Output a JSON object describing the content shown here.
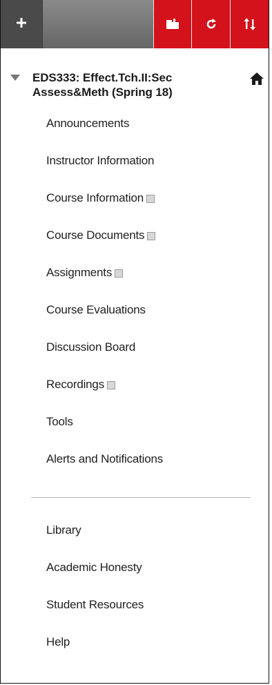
{
  "toolbar": {
    "icons": [
      "plus-icon",
      "folder-icon",
      "refresh-icon",
      "sort-icon"
    ],
    "accent_color": "#d3121b"
  },
  "course": {
    "title_line1": "EDS333: Effect.Tch.II:Sec",
    "title_line2": "Assess&Meth (Spring 18)"
  },
  "menu": {
    "items": [
      {
        "label": "Announcements"
      },
      {
        "label": "Instructor Information"
      },
      {
        "label": "Course Information"
      },
      {
        "label": "Course Documents"
      },
      {
        "label": "Assignments"
      },
      {
        "label": "Course Evaluations"
      },
      {
        "label": "Discussion Board"
      },
      {
        "label": "Recordings"
      },
      {
        "label": "Tools"
      },
      {
        "label": "Alerts and Notifications"
      }
    ],
    "secondary": [
      {
        "label": "Library"
      },
      {
        "label": "Academic Honesty"
      },
      {
        "label": "Student Resources"
      },
      {
        "label": "Help"
      }
    ]
  }
}
